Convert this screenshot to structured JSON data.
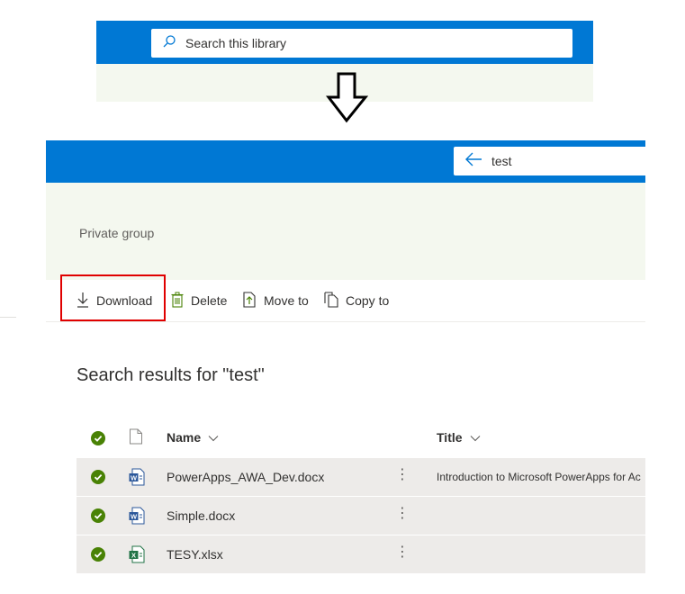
{
  "before": {
    "search": {
      "placeholder": "Search this library",
      "icon": "search-icon"
    }
  },
  "after": {
    "search": {
      "value": "test",
      "icon": "back-arrow-icon"
    },
    "group_type": "Private group",
    "commands": [
      {
        "label": "Download",
        "icon": "download-icon"
      },
      {
        "label": "Delete",
        "icon": "trash-icon"
      },
      {
        "label": "Move to",
        "icon": "move-icon"
      },
      {
        "label": "Copy to",
        "icon": "copy-icon"
      }
    ],
    "results_title": "Search results for \"test\"",
    "columns": {
      "name": "Name",
      "title": "Title"
    },
    "rows": [
      {
        "name": "PowerApps_AWA_Dev.docx",
        "type": "word",
        "title": "Introduction to Microsoft PowerApps for Ac"
      },
      {
        "name": "Simple.docx",
        "type": "word",
        "title": ""
      },
      {
        "name": "TESY.xlsx",
        "type": "excel",
        "title": ""
      }
    ]
  },
  "colors": {
    "suite_bar": "#0078d4",
    "header_bg": "#f4f8ef",
    "selected_row": "#edebe9",
    "check": "#498205",
    "highlight": "#e00000",
    "word": "#2b579a",
    "excel": "#217346"
  }
}
